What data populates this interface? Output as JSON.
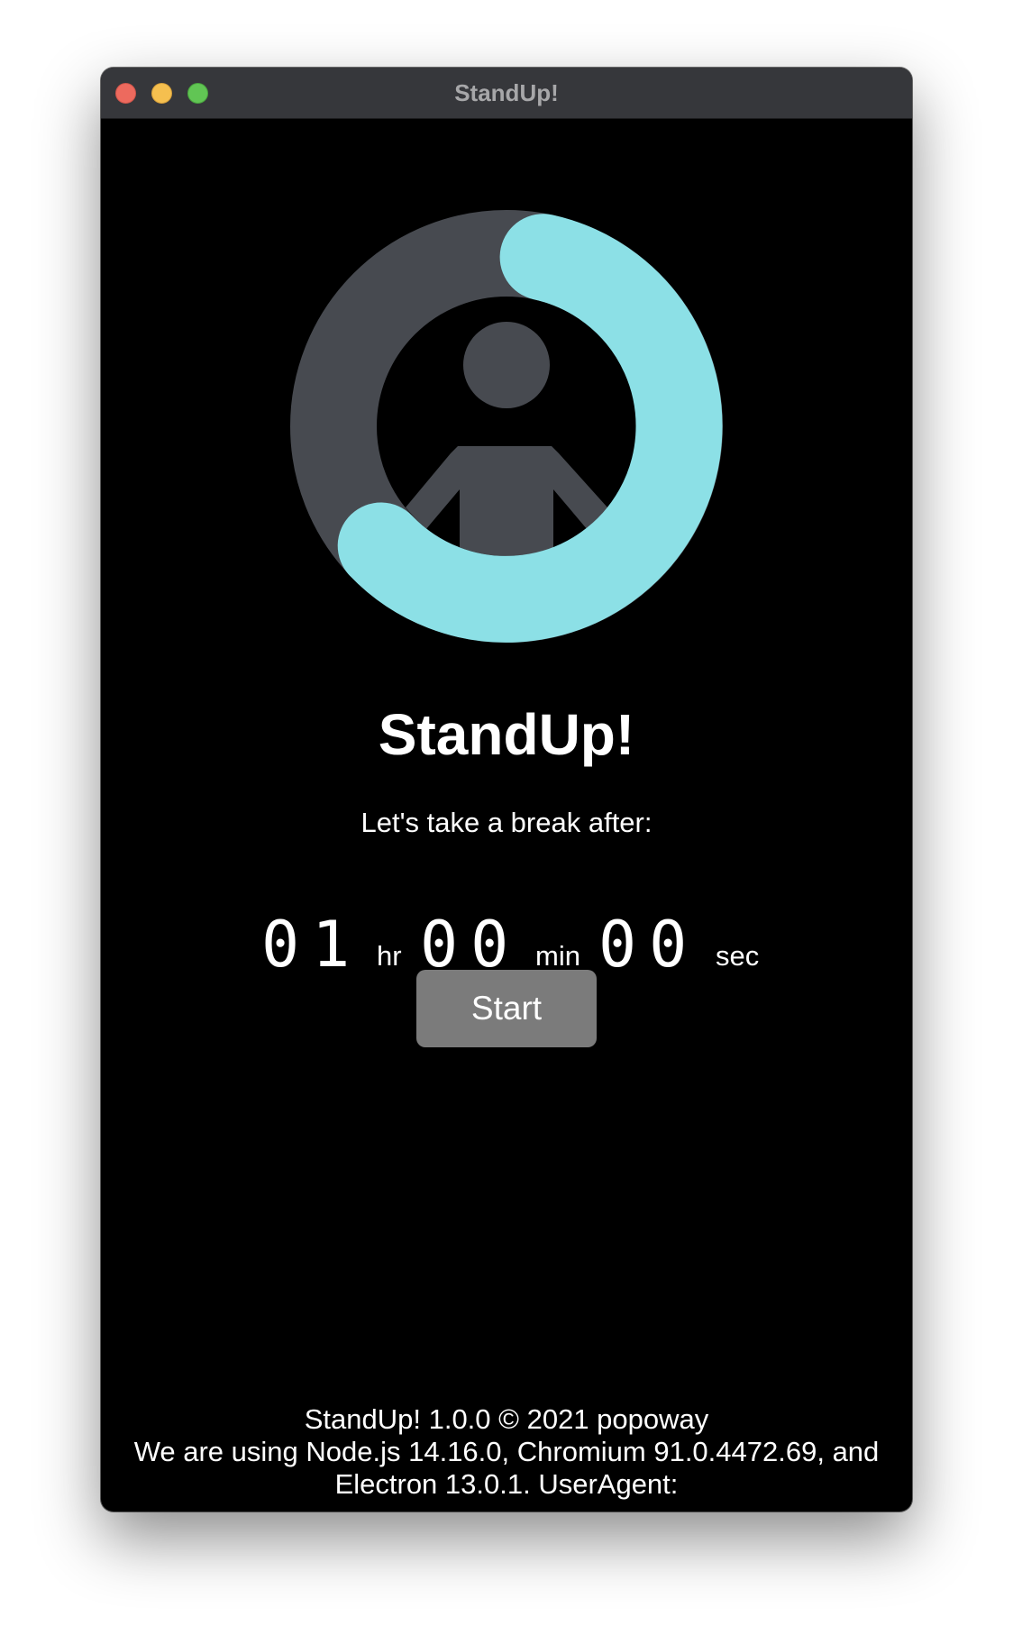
{
  "window": {
    "title": "StandUp!"
  },
  "ring": {
    "progress_color": "#8ce0e6",
    "track_color": "#474a50",
    "figure_color": "#474a50"
  },
  "main": {
    "app_title": "StandUp!",
    "subtitle": "Let's take a break after:",
    "timer": {
      "hours": "01",
      "hours_unit": "hr",
      "minutes": "00",
      "minutes_unit": "min",
      "seconds": "00",
      "seconds_unit": "sec"
    },
    "start_label": "Start"
  },
  "footer": {
    "line1": "StandUp! 1.0.0 © 2021 popoway",
    "line2": "We are using Node.js 14.16.0, Chromium 91.0.4472.69, and",
    "line3": "Electron 13.0.1. UserAgent:"
  }
}
